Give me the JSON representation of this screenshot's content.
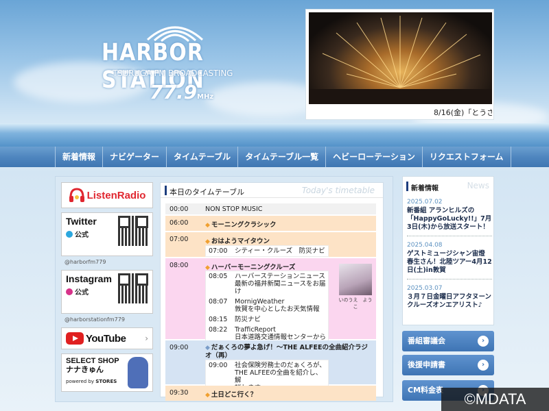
{
  "logo": {
    "title": "HARBOR STATION",
    "subtitle": "TSURUGA FM BROADCASTING",
    "frequency": "77.9",
    "unit": "MHz"
  },
  "slideshow": {
    "caption": "8/16(金)「とうさ"
  },
  "nav": {
    "items": [
      "新着情報",
      "ナビゲーター",
      "タイムテーブル",
      "タイムテーブル一覧",
      "ヘビーローテーション",
      "リクエストフォーム"
    ]
  },
  "banners": {
    "listen_radio": "ListenRadio",
    "twitter": {
      "name": "Twitter",
      "official": "公式",
      "handle": "@harborfm779"
    },
    "instagram": {
      "name": "Instagram",
      "official": "公式",
      "handle": "@harborstationfm779"
    },
    "youtube": "YouTube",
    "shop": {
      "line1": "SELECT SHOP",
      "line2": "ナナきゅん",
      "powered": "powered by",
      "brand": "STORES"
    }
  },
  "timetable": {
    "title": "本日のタイムテーブル",
    "title_en": "Today's timetable",
    "rows": [
      {
        "time": "00:00",
        "title": "NON STOP MUSIC"
      },
      {
        "time": "06:00",
        "title": "モーニングクラシック"
      },
      {
        "time": "07:00",
        "title": "おはようマイタウン",
        "subs": [
          {
            "time": "07:00",
            "text": "シティー・クルーズ　防災ナビ"
          }
        ]
      },
      {
        "time": "08:00",
        "title": "ハーバーモーニングクルーズ",
        "subs": [
          {
            "time": "08:05",
            "text": "ハーバーステーションニュース\n最新の福井新聞ニュースをお届け"
          },
          {
            "time": "08:07",
            "text": "MornigWeather\n敦賀を中心としたお天気情報"
          },
          {
            "time": "08:15",
            "text": "防災ナビ"
          },
          {
            "time": "08:22",
            "text": "TrafficReport\n日本道路交通情報センターからの\n最新の道路情報をお届け"
          }
        ],
        "navigator": "いのうえ　ようこ"
      },
      {
        "time": "09:00",
        "title": "だぁくろの夢よ急げ！～THE ALFEEの全曲紹介ラジオ（再）",
        "subs": [
          {
            "time": "09:00",
            "text": "社会保険労務士のだぁくろが、\nTHE ALFEEの全曲を紹介し、解\n説します。"
          }
        ]
      },
      {
        "time": "09:30",
        "title": "土日どこ行く？"
      }
    ]
  },
  "news": {
    "title": "新着情報",
    "title_en": "News",
    "items": [
      {
        "date": "2025.07.02",
        "text": "新番組 アランヒルズの「HappyGoLucky!!」7月3日(木)から放送スタート！"
      },
      {
        "date": "2025.04.08",
        "text": "ゲストミュージシャン宙燈 春生さん！北陸ツアー4月12日(土)in敦賀"
      },
      {
        "date": "2025.03.07",
        "text": "３月７日金曜日アフタヌーンクルーズオンエアリスト♪"
      }
    ]
  },
  "side_buttons": [
    "番組審議会",
    "後援申請書",
    "CM料金表"
  ],
  "watermark": "©MDATA",
  "colors": {
    "nav": "#4f86bf",
    "accent_dark": "#1d3e7e",
    "row_orange": "#fde3c6",
    "row_pink": "#fbd6ef",
    "row_blue": "#d5e3f3",
    "row_gray": "#f1f1f1"
  }
}
